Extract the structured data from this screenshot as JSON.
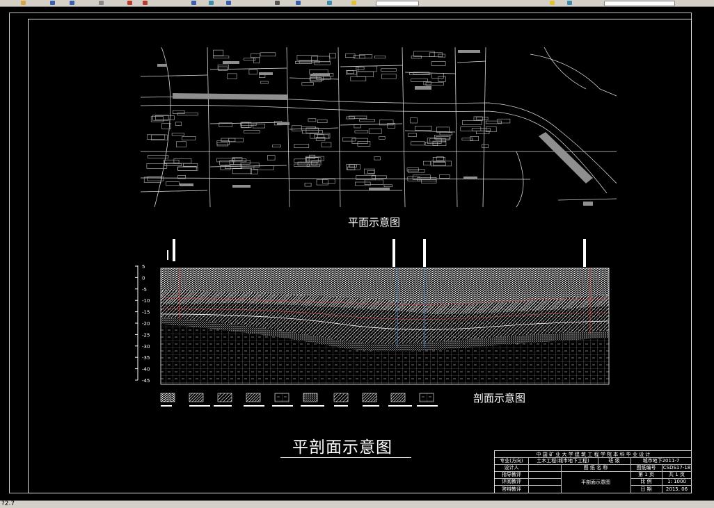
{
  "status": {
    "text": "?2.7"
  },
  "titles": {
    "plan": "平面示意图",
    "section": "剖面示意图",
    "main": "平剖面示意图"
  },
  "depth_axis": {
    "ticks": [
      "5",
      "0",
      "-5",
      "-10",
      "-15",
      "-20",
      "-25",
      "-30",
      "-35",
      "-40",
      "-45"
    ]
  },
  "title_block": {
    "school": "中 国 矿 业 大 学 建 筑 工 程 学 院 本 科 毕 业 设 计",
    "major_label": "专业(方向)",
    "major_value": "土木工程(城市地下工程)",
    "class_label": "班  级",
    "class_value": "城市地下2011-7",
    "designer_label": "设计人",
    "drawing_name_label": "图 纸 名 称",
    "drawing_no_label": "图纸编号",
    "drawing_no_value": "CSDS17-18",
    "advisor_label": "指导教评",
    "drawing_name_value": "平剖面示意图",
    "sheet_label": "第 1 页",
    "sheet_total": "共 1 页",
    "reviewer_label": "评阅教评",
    "scale_label": "比  例",
    "scale_value": "1: 1000",
    "defense_label": "答辩教评",
    "date_label": "日  期",
    "date_value": "2015. 06"
  }
}
